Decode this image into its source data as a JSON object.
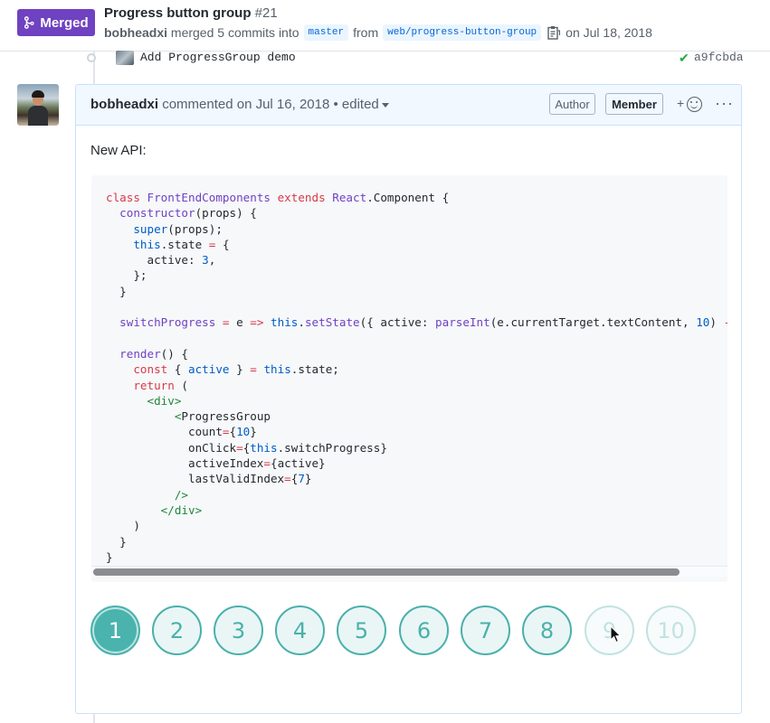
{
  "header": {
    "badge": "Merged",
    "title": "Progress button group",
    "number": "#21",
    "author": "bobheadxi",
    "merged_text": "merged 5 commits into",
    "base_branch": "master",
    "from_text": "from",
    "head_branch": "web/progress-button-group",
    "date_text": "on Jul 18, 2018"
  },
  "commit": {
    "message": "Add ProgressGroup demo",
    "sha": "a9fcbda"
  },
  "comment": {
    "author": "bobheadxi",
    "commented_text": "commented on Jul 16, 2018",
    "edited_text": "• edited",
    "label_author": "Author",
    "label_member": "Member",
    "reaction_plus": "+",
    "more": "···",
    "body": "New API:"
  },
  "progress": {
    "buttons": [
      "1",
      "2",
      "3",
      "4",
      "5",
      "6",
      "7",
      "8",
      "9",
      "10"
    ],
    "active": 1,
    "last_valid": 8
  },
  "colors": {
    "merged": "#6f42c1",
    "teal": "#4ab3ae",
    "link": "#0366d6"
  }
}
